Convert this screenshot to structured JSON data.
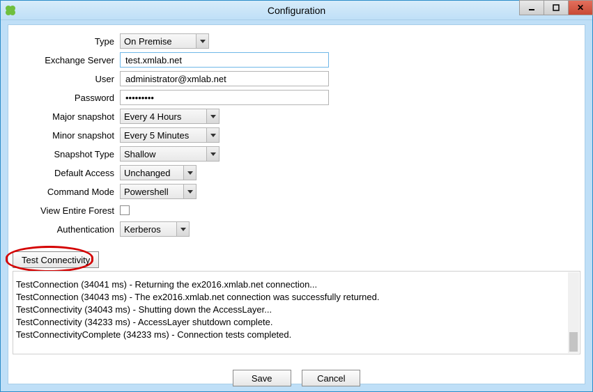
{
  "window": {
    "title": "Configuration"
  },
  "form": {
    "labels": {
      "type": "Type",
      "exchange_server": "Exchange Server",
      "user": "User",
      "password": "Password",
      "major_snapshot": "Major snapshot",
      "minor_snapshot": "Minor snapshot",
      "snapshot_type": "Snapshot Type",
      "default_access": "Default Access",
      "command_mode": "Command Mode",
      "view_entire_forest": "View Entire Forest",
      "authentication": "Authentication"
    },
    "values": {
      "type": "On Premise",
      "exchange_server": "test.xmlab.net",
      "user": "administrator@xmlab.net",
      "password": "•••••••••",
      "major_snapshot": "Every 4 Hours",
      "minor_snapshot": "Every 5 Minutes",
      "snapshot_type": "Shallow",
      "default_access": "Unchanged",
      "command_mode": "Powershell",
      "view_entire_forest": false,
      "authentication": "Kerberos"
    }
  },
  "buttons": {
    "test_connectivity": "Test Connectivity",
    "save": "Save",
    "cancel": "Cancel"
  },
  "log_lines": [
    "TestConnection (34041 ms) - Returning the ex2016.xmlab.net connection...",
    "TestConnection (34043 ms) - The ex2016.xmlab.net connection was successfully returned.",
    "TestConnectivity (34043 ms) - Shutting down the AccessLayer...",
    "TestConnectivity (34233 ms) - AccessLayer shutdown complete.",
    "TestConnectivityComplete (34233 ms) - Connection tests completed."
  ],
  "highlight": {
    "target": "test-connectivity-button"
  }
}
